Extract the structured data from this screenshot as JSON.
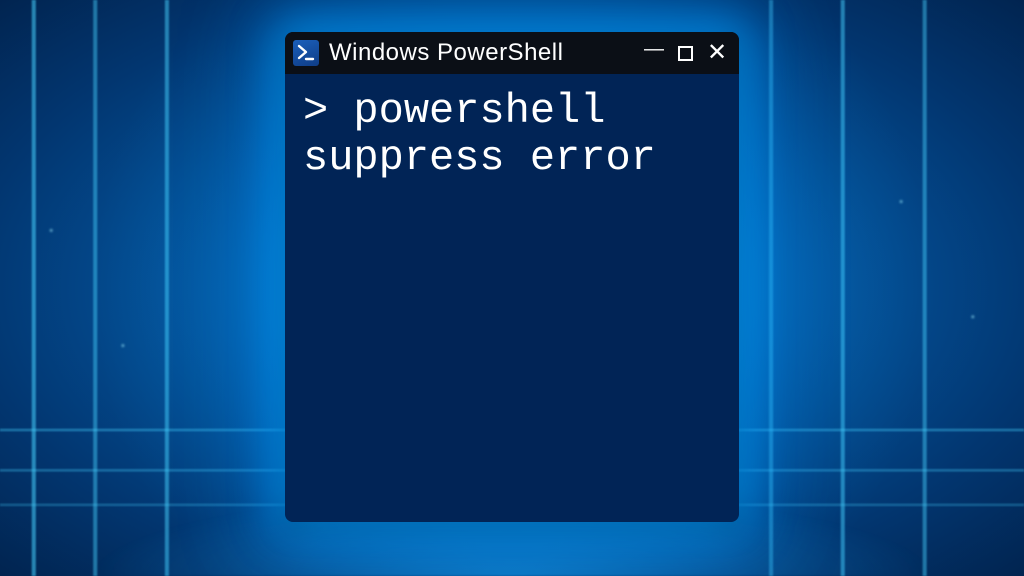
{
  "window": {
    "title": "Windows PowerShell",
    "icon_name": "powershell-icon"
  },
  "terminal": {
    "prompt": "> ",
    "command": "powershell suppress error"
  },
  "colors": {
    "console_bg": "#012456",
    "titlebar_bg": "#0b0f16",
    "text": "#ffffff",
    "glow": "#00a8ff"
  }
}
